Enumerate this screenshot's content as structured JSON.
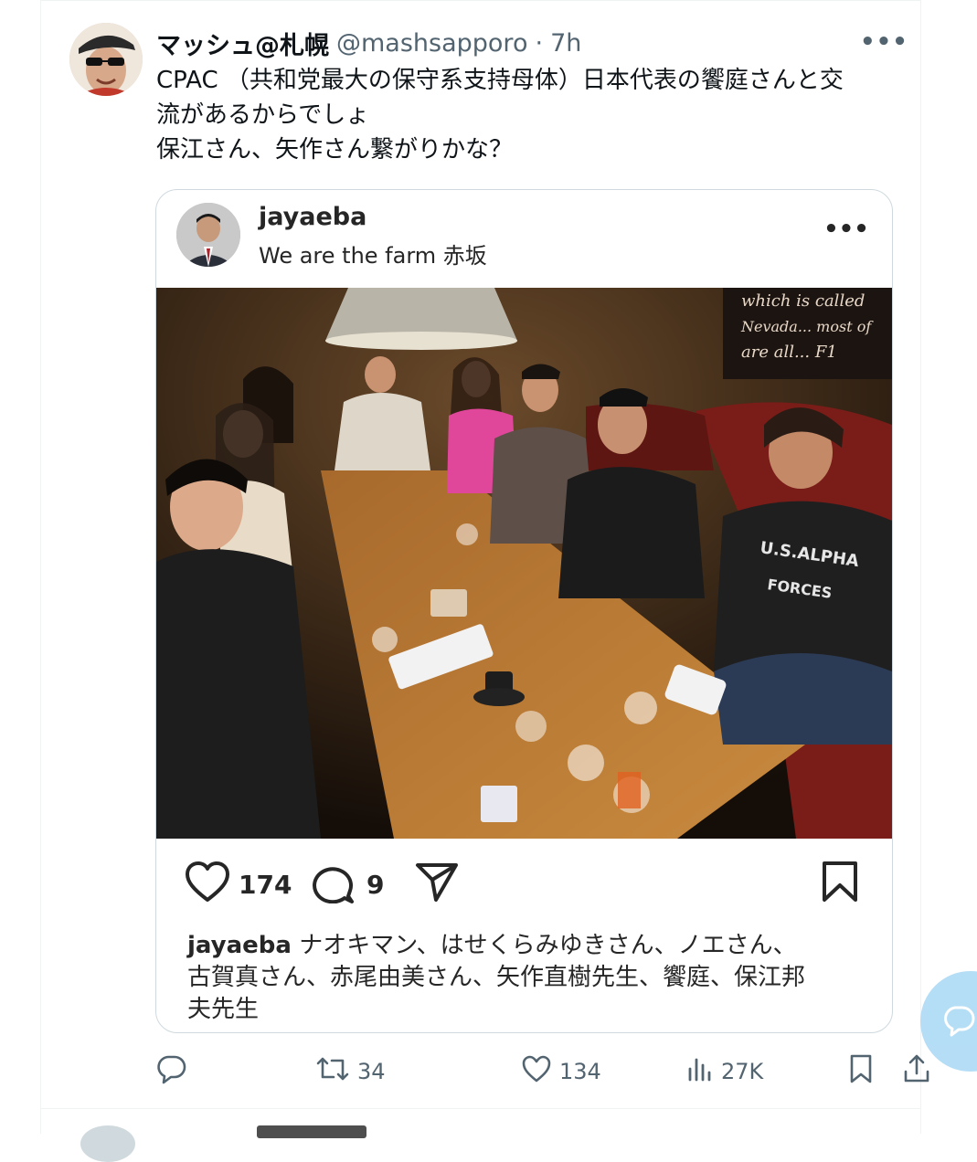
{
  "tweet": {
    "display_name": "マッシュ@札幌",
    "handle": "@mashsapporo",
    "separator": "·",
    "time": "7h",
    "more_label": "•••",
    "text_lines": [
      "CPAC （共和党最大の保守系支持母体）日本代表の饗庭さんと交",
      "流があるからでしょ",
      "保江さん、矢作さん繋がりかな？"
    ]
  },
  "embed": {
    "username": "jayaeba",
    "location": "We are the farm 赤坂",
    "more_label": "•••",
    "photo_sign_text": "which is called Nevada... most of are all... F1",
    "photo_shirt_text": "U.S.ALPHA FORCES",
    "likes": "174",
    "comments": "9",
    "caption_user": "jayaeba",
    "caption_lines": [
      " ナオキマン、はせくらみゆきさん、ノエさん、",
      "古賀真さん、赤尾由美さん、矢作直樹先生、饗庭、保江邦",
      "夫先生"
    ]
  },
  "actions": {
    "reply_count": "",
    "retweet_count": "34",
    "like_count": "134",
    "views_count": "27K"
  },
  "icons": {
    "reply": "reply-icon",
    "retweet": "retweet-icon",
    "like": "heart-icon",
    "views": "views-icon",
    "bookmark": "bookmark-icon",
    "share": "share-icon",
    "compose": "compose-fab-icon"
  },
  "colors": {
    "text": "#0f1419",
    "secondary": "#536471",
    "border": "#cfd9de",
    "fab": "#a8d8f5"
  }
}
